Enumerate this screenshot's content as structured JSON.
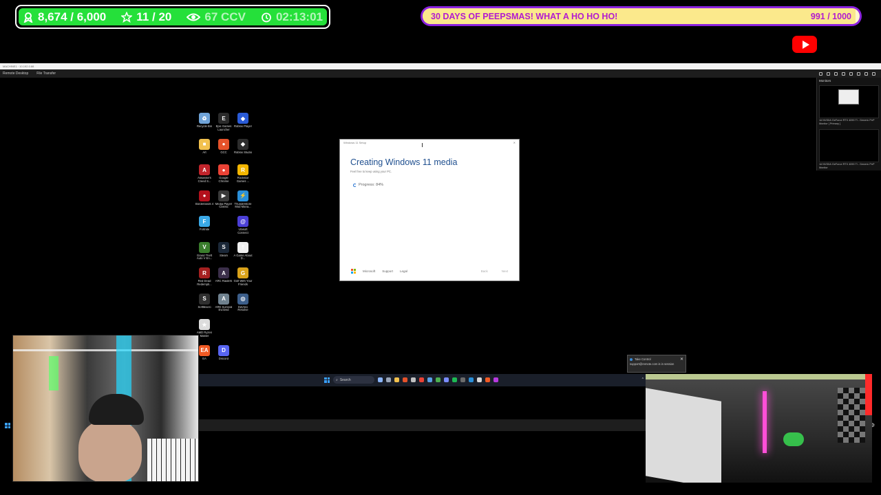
{
  "overlay": {
    "stats": [
      {
        "icon": "followers-icon",
        "text": "8,674 / 6,000"
      },
      {
        "icon": "star-icon",
        "text": "11 / 20"
      },
      {
        "icon": "eye-icon",
        "text": "67 CCV"
      },
      {
        "icon": "timer-icon",
        "text": "02:13:01"
      }
    ],
    "goal": {
      "label": "30 DAYS OF PEEPSMAS! WHAT A HO HO HO!",
      "count": "991 / 1000",
      "progress": 0.991
    },
    "colors": {
      "stats_bg": "#25e03a",
      "goal_border": "#8b22e0",
      "goal_text": "#b21ad0",
      "youtube": "#ff0000"
    }
  },
  "remote_desktop": {
    "title": "MACHINE1 · 10.192.0.88",
    "tabs": [
      "Remote Desktop",
      "File Transfer"
    ],
    "monitors_panel": {
      "title": "Monitors",
      "monitors": [
        {
          "label": "1# NVIDIA GeForce RTX 4090 Ti - Generic PnP Monitor [ Primary ]"
        },
        {
          "label": "1# NVIDIA GeForce RTX 4090 Ti - Generic PnP Monitor"
        }
      ]
    }
  },
  "desktop": {
    "icons": [
      {
        "label": "Recycle Bin",
        "color": "#6fa3d8",
        "glyph": "♻"
      },
      {
        "label": "Epic Games Launcher",
        "color": "#2b2b2b",
        "glyph": "E"
      },
      {
        "label": "Roblox Player",
        "color": "#2a5bd7",
        "glyph": "◆"
      },
      {
        "label": "Art",
        "color": "#f2c14e",
        "glyph": "■"
      },
      {
        "label": "GCC",
        "color": "#e5522a",
        "glyph": "●"
      },
      {
        "label": "Roblox Studio",
        "color": "#2d2d2d",
        "glyph": "◆"
      },
      {
        "label": "Assassin's Creed S...",
        "color": "#c0242b",
        "glyph": "A"
      },
      {
        "label": "Google Chrome",
        "color": "#e94235",
        "glyph": "●"
      },
      {
        "label": "Rockstar Games ...",
        "color": "#f3b600",
        "glyph": "R"
      },
      {
        "label": "Borderlands 4",
        "color": "#b3101c",
        "glyph": "●"
      },
      {
        "label": "Media Player Classic",
        "color": "#3a3a3a",
        "glyph": "▶"
      },
      {
        "label": "Thunderstore Mod Mana...",
        "color": "#2a8fd8",
        "glyph": "⚡"
      },
      {
        "label": "Fortnite",
        "color": "#3aa9e6",
        "glyph": "F"
      },
      {
        "label": "",
        "color": "#000000",
        "glyph": ""
      },
      {
        "label": "Ubisoft Connect",
        "color": "#4b3fd6",
        "glyph": "@"
      },
      {
        "label": "Grand Theft Auto V En...",
        "color": "#3a7d2c",
        "glyph": "V"
      },
      {
        "label": "Steam",
        "color": "#1b2838",
        "glyph": "S"
      },
      {
        "label": "A Game About D...",
        "color": "#efefef",
        "glyph": "†"
      },
      {
        "label": "Red Dead Redempti...",
        "color": "#a52020",
        "glyph": "R"
      },
      {
        "label": "ARC Raiders",
        "color": "#3b2f4a",
        "glyph": "A"
      },
      {
        "label": "Golf With Your Friends",
        "color": "#d9a21a",
        "glyph": "G"
      },
      {
        "label": "SoftMacro",
        "color": "#2f2f2f",
        "glyph": "S"
      },
      {
        "label": "ARK Survival Evolved",
        "color": "#70828f",
        "glyph": "A"
      },
      {
        "label": "DaVinci Resolve",
        "color": "#3c5e8a",
        "glyph": "◎"
      },
      {
        "label": "AMD Ryzen Master",
        "color": "#dddddd",
        "glyph": "★"
      },
      {
        "label": "",
        "color": "#000000",
        "glyph": ""
      },
      {
        "label": "",
        "color": "#000000",
        "glyph": ""
      },
      {
        "label": "EA",
        "color": "#f15a24",
        "glyph": "EA"
      },
      {
        "label": "Discord",
        "color": "#5865f2",
        "glyph": "D"
      }
    ]
  },
  "setup_dialog": {
    "title": "Windows 11 Setup",
    "heading": "Creating Windows 11 media",
    "subtitle": "Feel free to keep using your PC.",
    "progress_label": "Progress: 84%",
    "footer": {
      "brand": "Microsoft",
      "support": "Support",
      "legal": "Legal",
      "back": "Back",
      "next": "Next"
    }
  },
  "taskbar": {
    "search_label": "Search",
    "tray": "^"
  },
  "toast": {
    "title": "Take Control",
    "body": "support@remote.com is in session"
  }
}
